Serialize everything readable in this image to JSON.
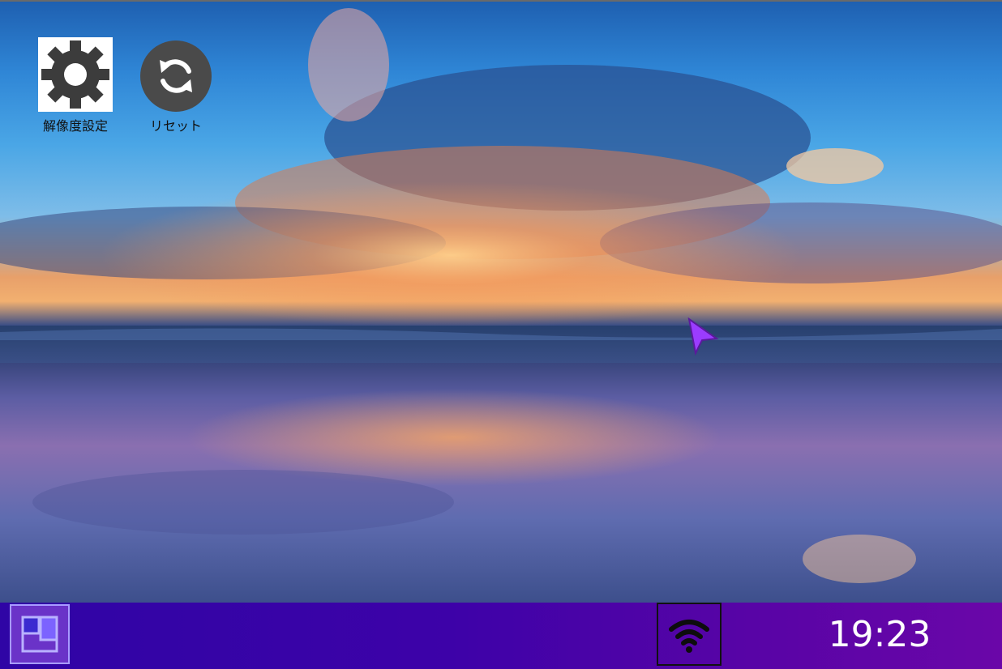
{
  "desktop": {
    "icons": [
      {
        "label": "解像度設定",
        "icon": "gear-icon"
      },
      {
        "label": "リセット",
        "icon": "refresh-icon"
      }
    ]
  },
  "taskbar": {
    "start_icon": "start-menu-icon",
    "wifi_icon": "wifi-icon",
    "clock": "19:23"
  },
  "colors": {
    "taskbar_start": "#2f05a5",
    "taskbar_end": "#6a06a8",
    "cursor": "#9b3cff"
  }
}
